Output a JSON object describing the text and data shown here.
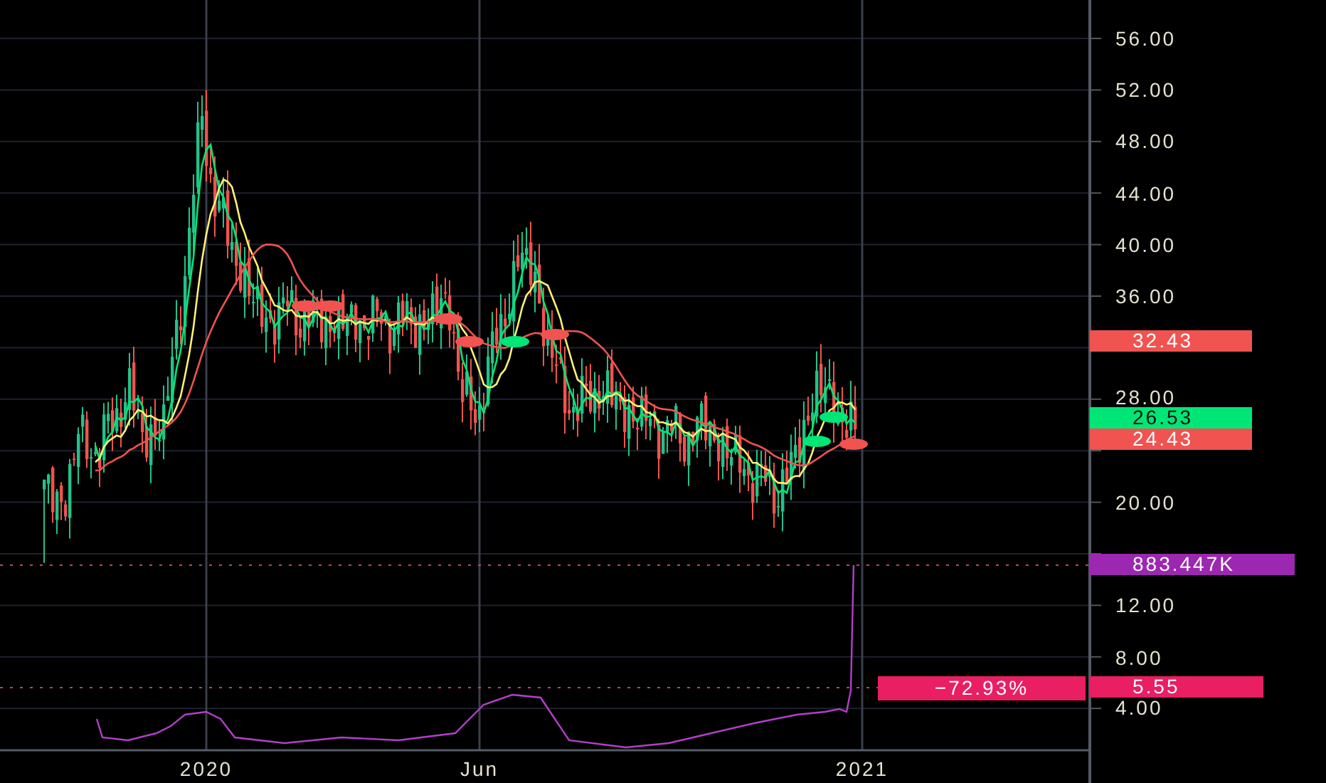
{
  "price_axis": {
    "ticks": [
      "56.00",
      "52.00",
      "48.00",
      "44.00",
      "40.00",
      "36.00",
      "28.00",
      "20.00",
      "12.00",
      "8.00",
      "4.00"
    ]
  },
  "time_axis": {
    "labels": [
      "2020",
      "Jun",
      "2021"
    ]
  },
  "price_labels": [
    {
      "text": "32.43",
      "color": "#f05350"
    },
    {
      "text": "26.53",
      "color": "#00e676"
    },
    {
      "text": "24.43",
      "color": "#f05350"
    },
    {
      "text": "883.447K",
      "color": "#9c27b0"
    },
    {
      "text": "5.55",
      "color": "#e91e63"
    }
  ],
  "indicator_badge": {
    "text": "−72.93%",
    "color": "#e91e63"
  }
}
